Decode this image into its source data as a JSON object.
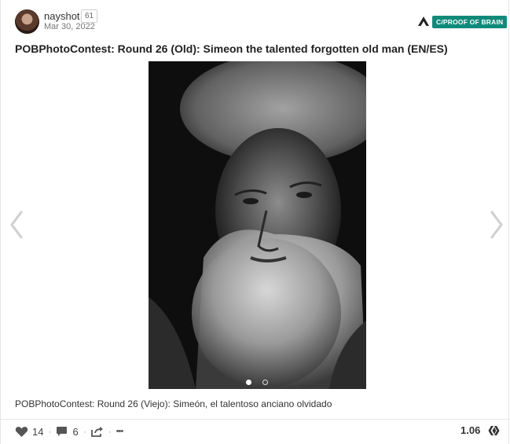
{
  "post": {
    "author": "nayshot",
    "reputation": "61",
    "date": "Mar 30, 2022",
    "community": "C/PROOF OF BRAIN",
    "title": "POBPhotoContest: Round 26 (Old): Simeon the talented forgotten old man (EN/ES)",
    "caption": "POBPhotoContest: Round 26 (Viejo): Simeón, el talentoso anciano olvidado"
  },
  "footer": {
    "votes": "14",
    "comments": "6",
    "more": "•••",
    "payout": "1.06"
  },
  "carousel": {
    "slides_total": 2,
    "active_index": 0
  },
  "colors": {
    "accent": "#0f8a7a",
    "icon": "#555555"
  },
  "icons": [
    "heart-icon",
    "comment-icon",
    "reblog-icon",
    "more-icon",
    "hive-icon",
    "community-logo-icon",
    "chevron-left-icon",
    "chevron-right-icon"
  ]
}
